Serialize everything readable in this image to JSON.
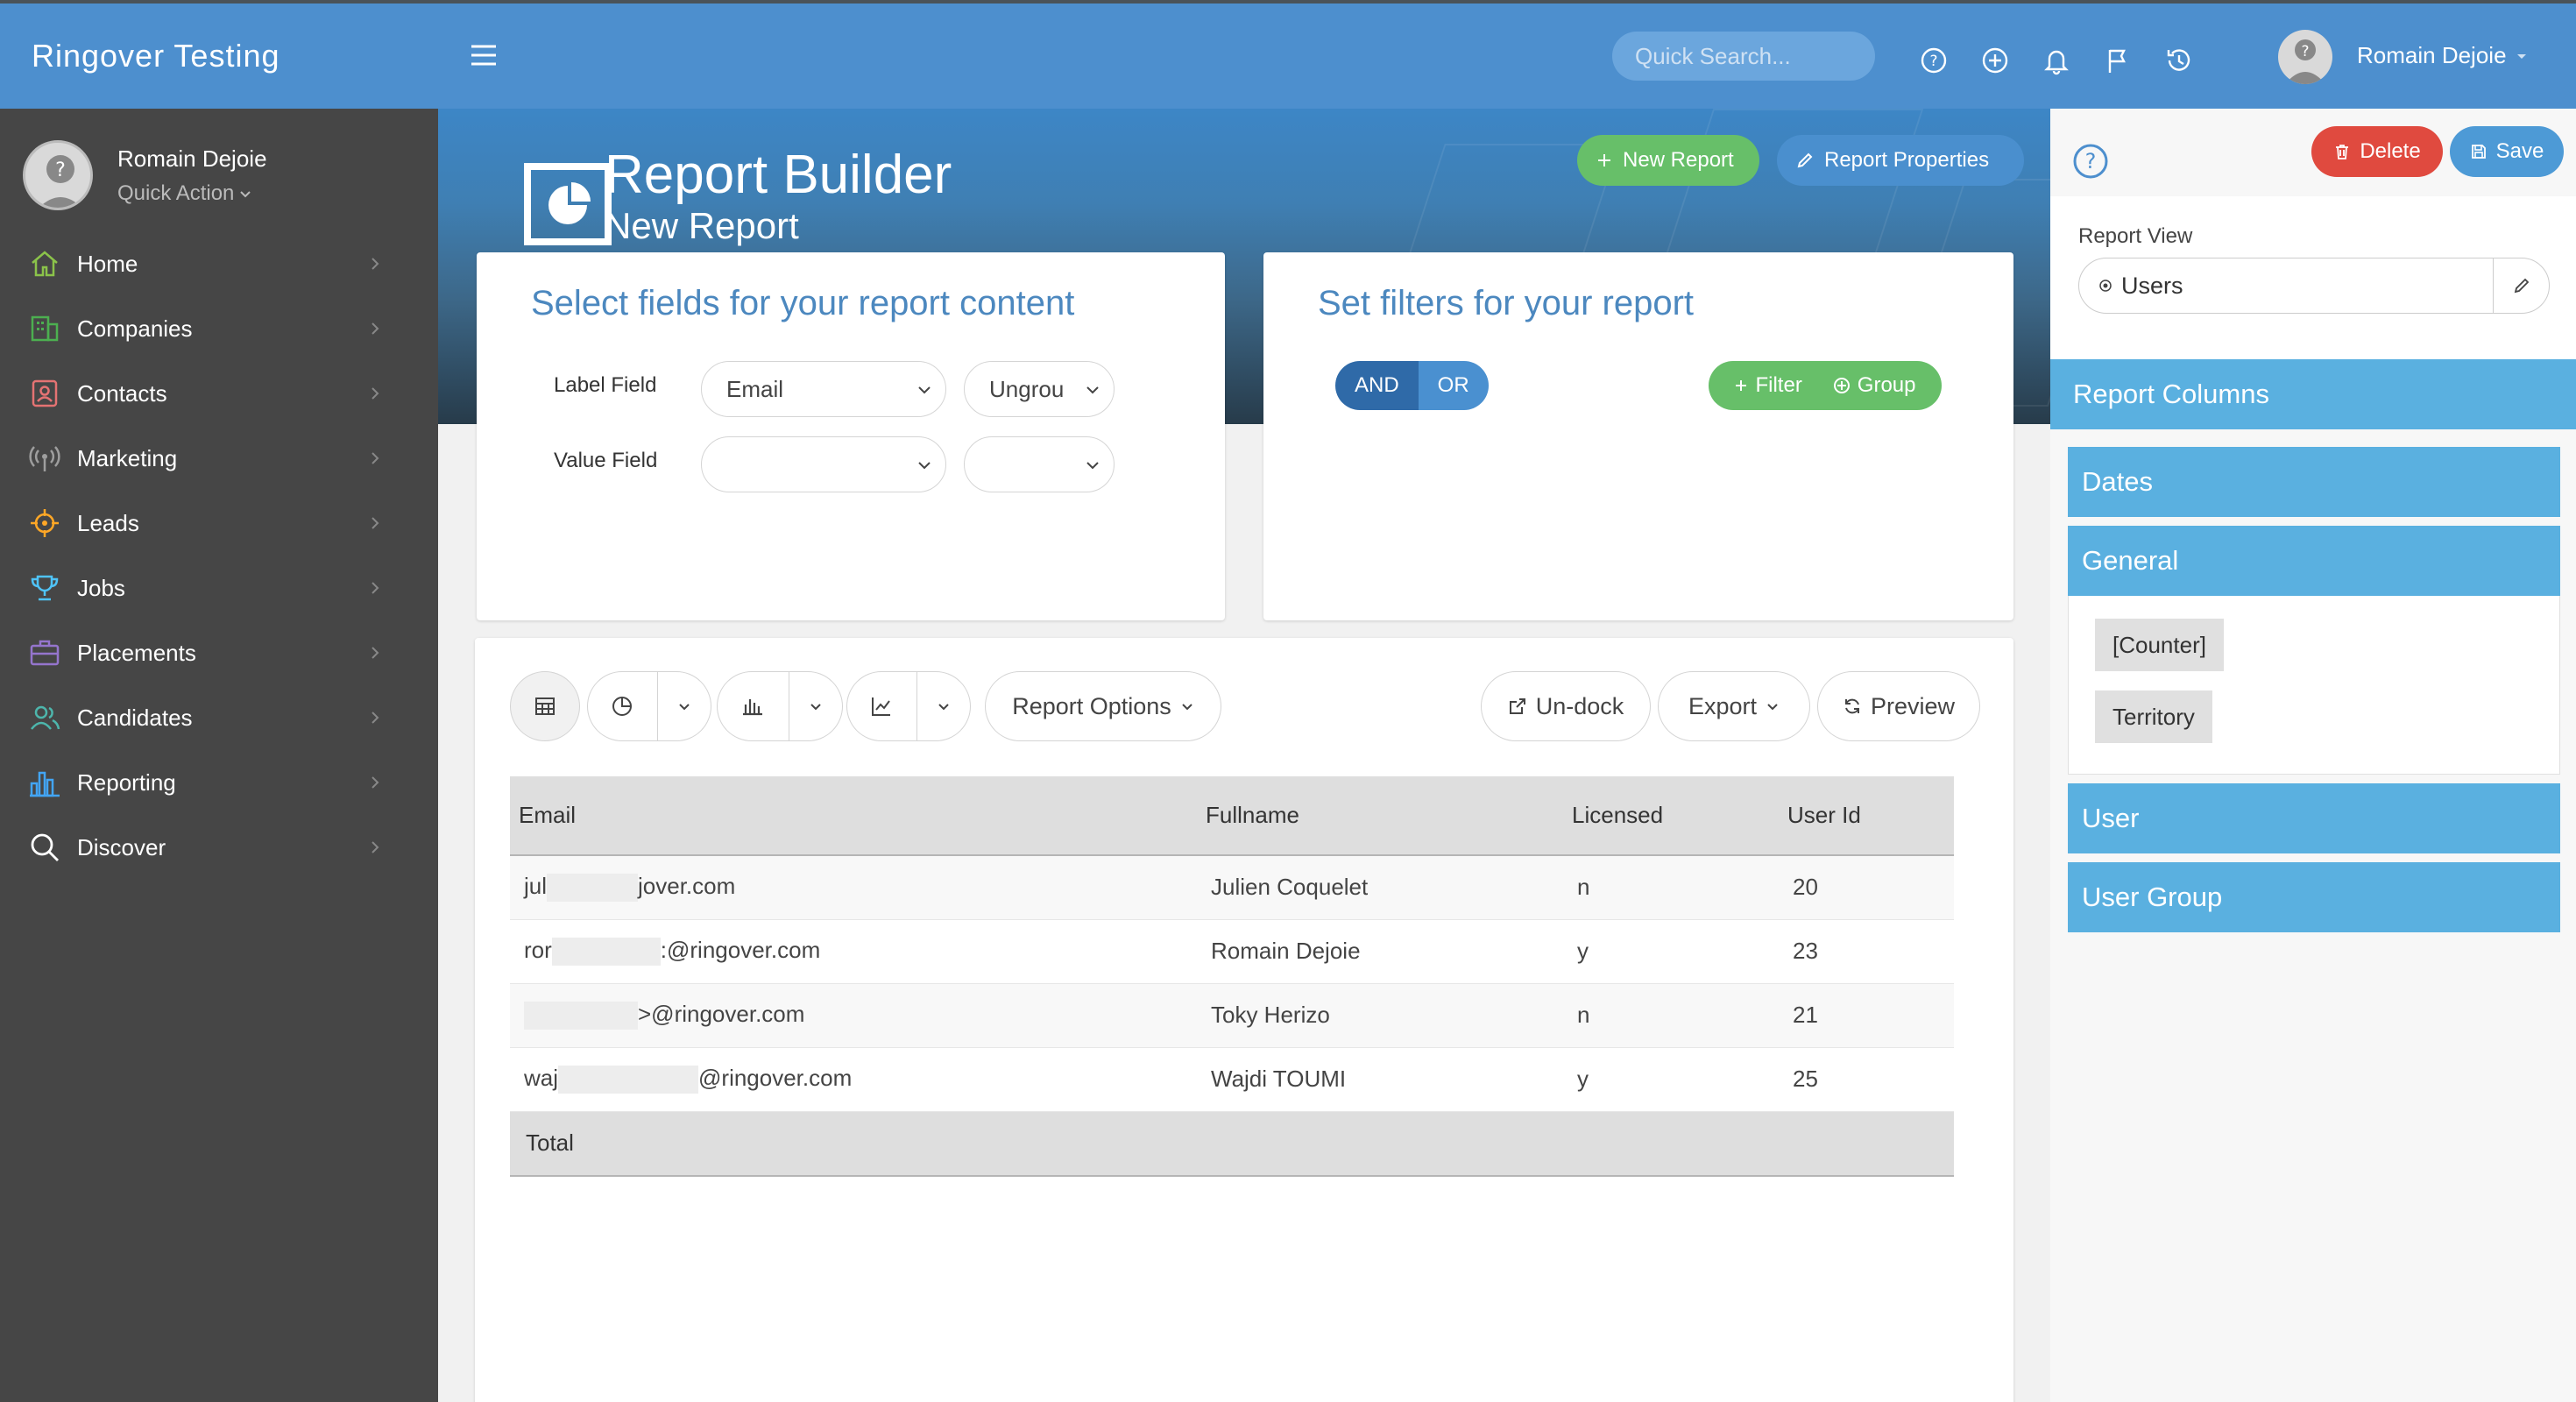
{
  "app": {
    "brand": "Ringover Testing"
  },
  "user": {
    "name": "Romain Dejoie",
    "quick_action": "Quick Action"
  },
  "nav": [
    {
      "label": "Home",
      "icon": "home-icon",
      "color": "#8bc34a"
    },
    {
      "label": "Companies",
      "icon": "companies-icon",
      "color": "#4caf50"
    },
    {
      "label": "Contacts",
      "icon": "contacts-icon",
      "color": "#e57373"
    },
    {
      "label": "Marketing",
      "icon": "broadcast-icon",
      "color": "#9e9e9e"
    },
    {
      "label": "Leads",
      "icon": "target-icon",
      "color": "#ffa726"
    },
    {
      "label": "Jobs",
      "icon": "trophy-icon",
      "color": "#4fc3f7"
    },
    {
      "label": "Placements",
      "icon": "briefcase-icon",
      "color": "#9575cd"
    },
    {
      "label": "Candidates",
      "icon": "users-icon",
      "color": "#4db6ac"
    },
    {
      "label": "Reporting",
      "icon": "bar-chart-icon",
      "color": "#42a5f5"
    },
    {
      "label": "Discover",
      "icon": "search-icon",
      "color": "#ffffff"
    }
  ],
  "topbar": {
    "search_placeholder": "Quick Search...",
    "username": "Romain Dejoie"
  },
  "hero": {
    "title": "Report Builder",
    "subtitle": "New Report",
    "new_report": "New Report",
    "report_properties": "Report Properties"
  },
  "fields_card": {
    "title": "Select fields for your report content",
    "label_field": "Label Field",
    "value_field": "Value Field",
    "label_select": "Email",
    "label_group": "Ungrou",
    "value_select": "",
    "value_group": ""
  },
  "filters_card": {
    "title": "Set filters for your report",
    "and": "AND",
    "or": "OR",
    "filter": "Filter",
    "group": "Group"
  },
  "toolbar": {
    "report_options": "Report Options",
    "undock": "Un-dock",
    "export": "Export",
    "preview": "Preview"
  },
  "table": {
    "columns": [
      "Email",
      "Fullname",
      "Licensed",
      "User Id"
    ],
    "rows": [
      {
        "email_start": "jul",
        "email_end": "jover.com",
        "fullname": "Julien Coquelet",
        "licensed": "n",
        "user_id": "20"
      },
      {
        "email_start": "ror",
        "email_end": ":@ringover.com",
        "fullname": "Romain Dejoie",
        "licensed": "y",
        "user_id": "23"
      },
      {
        "email_start": "",
        "email_end": ">@ringover.com",
        "fullname": "Toky Herizo",
        "licensed": "n",
        "user_id": "21"
      },
      {
        "email_start": "waj",
        "email_end": "@ringover.com",
        "fullname": "Wajdi TOUMI",
        "licensed": "y",
        "user_id": "25"
      }
    ],
    "total": "Total"
  },
  "right_panel": {
    "delete": "Delete",
    "save": "Save",
    "report_view_label": "Report View",
    "report_view_value": "Users",
    "report_columns": "Report Columns",
    "sections": [
      "Dates",
      "General",
      "User",
      "User Group"
    ],
    "general_items": [
      "[Counter]",
      "Territory"
    ]
  },
  "colors": {
    "primary": "#4d8fce",
    "green": "#67bf69",
    "red": "#e04a3f",
    "sidebar": "#464646",
    "section": "#5ab0e0"
  }
}
